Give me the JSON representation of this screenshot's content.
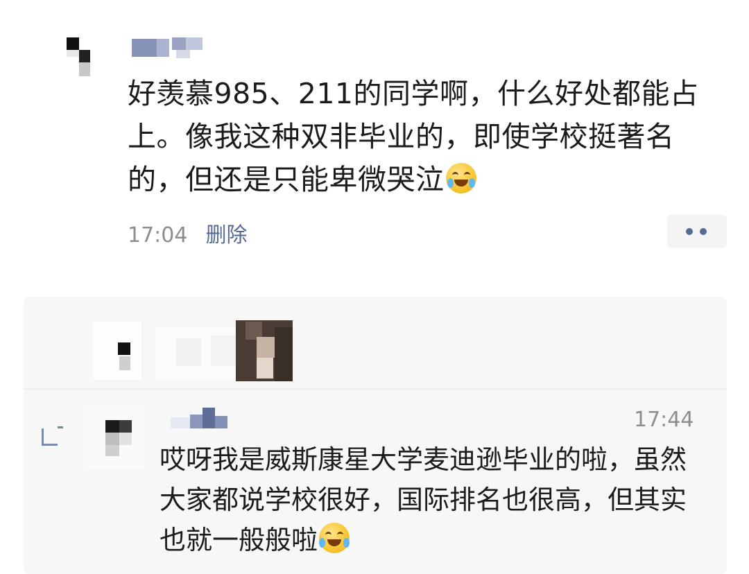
{
  "post": {
    "text": "好羡慕985、211的同学啊，什么好处都能占上。像我这种双非毕业的，即使学校挺著名的，但还是只能卑微哭泣",
    "emoji": "crying-laughing-emoji",
    "time": "17:04",
    "delete_label": "删除"
  },
  "comment": {
    "time": "17:44",
    "text": "哎呀我是威斯康星大学麦迪逊毕业的啦，虽然大家都说学校很好，国际排名也很高，但其实也就一般般啦",
    "emoji": "tears-of-joy-emoji"
  },
  "colors": {
    "link": "#576b95",
    "meta": "#8d8d8d",
    "comment_bg": "#f7f7f7"
  }
}
